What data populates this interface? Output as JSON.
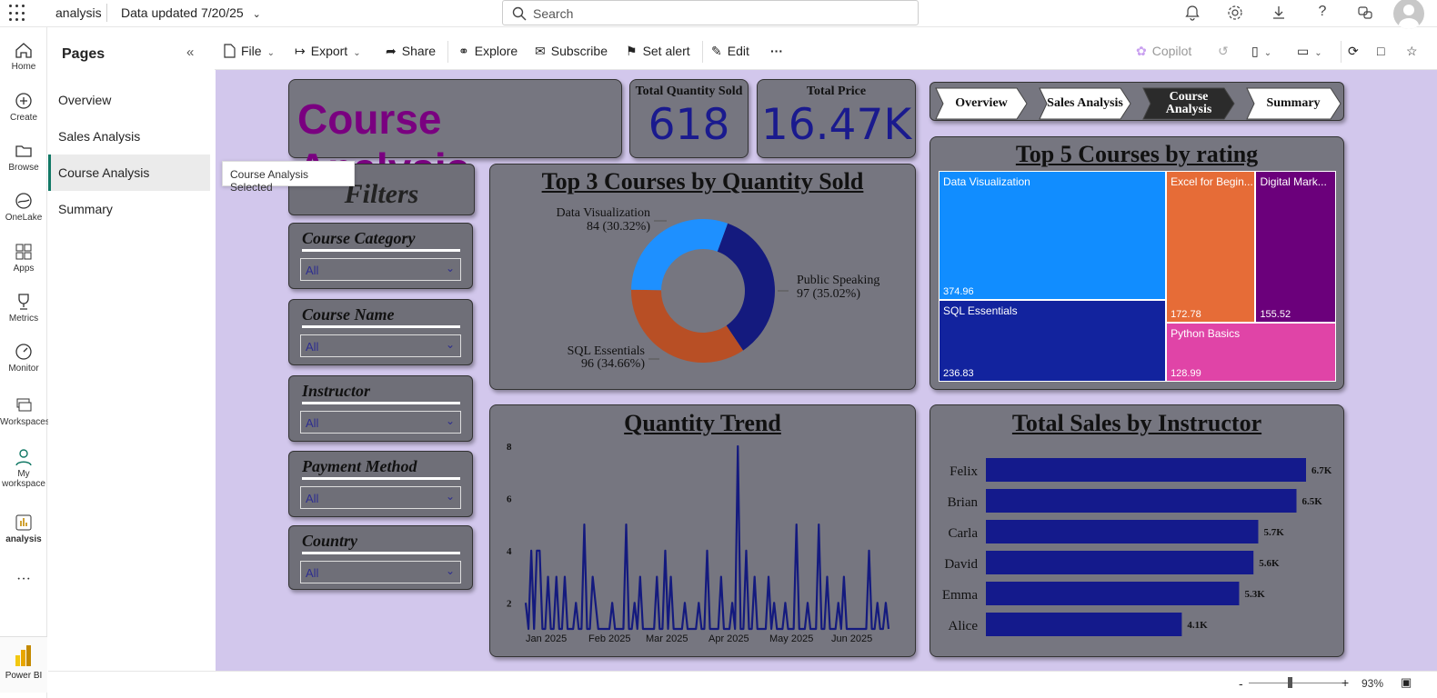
{
  "topbar": {
    "app_name": "analysis",
    "data_updated": "Data updated 7/20/25",
    "search_placeholder": "Search"
  },
  "leftnav": [
    {
      "label": "Home",
      "icon": "home-icon"
    },
    {
      "label": "Create",
      "icon": "plus-circle-icon"
    },
    {
      "label": "Browse",
      "icon": "folder-icon"
    },
    {
      "label": "OneLake",
      "icon": "onelake-icon"
    },
    {
      "label": "Apps",
      "icon": "apps-icon"
    },
    {
      "label": "Metrics",
      "icon": "trophy-icon"
    },
    {
      "label": "Monitor",
      "icon": "monitor-icon"
    },
    {
      "label": "Workspaces",
      "icon": "workspaces-icon"
    },
    {
      "label": "My workspace",
      "icon": "person-icon"
    },
    {
      "label": "analysis",
      "icon": "report-icon"
    },
    {
      "label": "...",
      "icon": "more-icon"
    }
  ],
  "powerbi_label": "Power BI",
  "pages_panel": {
    "title": "Pages",
    "items": [
      "Overview",
      "Sales Analysis",
      "Course Analysis",
      "Summary"
    ],
    "selected": "Course Analysis",
    "tooltip": "Course Analysis Selected"
  },
  "toolbar": {
    "file": "File",
    "export": "Export",
    "share": "Share",
    "explore": "Explore",
    "subscribe": "Subscribe",
    "set_alert": "Set alert",
    "edit": "Edit",
    "more": "···",
    "copilot": "Copilot"
  },
  "report": {
    "title": "Course Analysis",
    "kpi_qty_label": "Total Quantity Sold",
    "kpi_qty_value": "618",
    "kpi_price_label": "Total Price",
    "kpi_price_value": "16.47K",
    "nav_buttons": [
      "Overview",
      "Sales Analysis",
      "Course Analysis",
      "Summary"
    ],
    "filters_title": "Filters",
    "filters": [
      {
        "label": "Course Category",
        "value": "All"
      },
      {
        "label": "Course Name",
        "value": "All"
      },
      {
        "label": "Instructor",
        "value": "All"
      },
      {
        "label": "Payment Method",
        "value": "All"
      },
      {
        "label": "Country",
        "value": "All"
      }
    ]
  },
  "colors": {
    "canvas_bg": "#d2c7ec",
    "card_bg": "#767680",
    "title_purple": "#7a0080",
    "kpi_blue": "#1a1a8e",
    "bar_navy": "#141a8c"
  },
  "chart_data": [
    {
      "type": "pie",
      "title": "Top 3 Courses by Quantity Sold",
      "categories": [
        "Public Speaking",
        "SQL Essentials",
        "Data Visualization"
      ],
      "values": [
        97,
        96,
        84
      ],
      "labels": [
        "97 (35.02%)",
        "96 (34.66%)",
        "84 (30.32%)"
      ],
      "colors": [
        "#141a7e",
        "#b84f25",
        "#1e90ff"
      ]
    },
    {
      "type": "heatmap",
      "title": "Top 5 Courses by rating",
      "categories": [
        "Data Visualization",
        "SQL Essentials",
        "Excel for Begin...",
        "Digital Mark...",
        "Python Basics"
      ],
      "values": [
        374.96,
        236.83,
        172.78,
        155.52,
        128.99
      ],
      "value_labels": [
        "374.96",
        "236.83",
        "172.78",
        "155.52",
        "128.99"
      ],
      "colors": [
        "#118dff",
        "#12239e",
        "#e66c37",
        "#6b007b",
        "#e044a7"
      ]
    },
    {
      "type": "line",
      "title": "Quantity Trend",
      "x_ticks": [
        "Jan 2025",
        "Feb 2025",
        "Mar 2025",
        "Apr 2025",
        "May 2025",
        "Jun 2025"
      ],
      "y_ticks": [
        2,
        4,
        6,
        8
      ],
      "ylim": [
        1,
        8
      ],
      "values": [
        2,
        1,
        4,
        1,
        4,
        4,
        1,
        1,
        3,
        1,
        1,
        3,
        1,
        1,
        3,
        1,
        1,
        1,
        2,
        1,
        1,
        5,
        1,
        1,
        3,
        2,
        1,
        1,
        1,
        1,
        1,
        2,
        1,
        1,
        1,
        1,
        5,
        1,
        1,
        2,
        1,
        3,
        1,
        1,
        1,
        1,
        1,
        3,
        1,
        1,
        4,
        1,
        3,
        1,
        1,
        1,
        1,
        2,
        1,
        1,
        1,
        1,
        2,
        1,
        1,
        4,
        1,
        1,
        1,
        1,
        3,
        1,
        1,
        1,
        2,
        1,
        8,
        1,
        1,
        4,
        1,
        1,
        3,
        1,
        1,
        1,
        1,
        3,
        1,
        2,
        1,
        1,
        1,
        2,
        1,
        1,
        1,
        5,
        1,
        1,
        1,
        2,
        1,
        1,
        1,
        5,
        1,
        1,
        3,
        1,
        1,
        1,
        2,
        1,
        3,
        1,
        1,
        1,
        1,
        1,
        1,
        1,
        1,
        4,
        1,
        1,
        2,
        1,
        1,
        2,
        1
      ]
    },
    {
      "type": "bar",
      "title": "Total Sales by Instructor",
      "categories": [
        "Felix",
        "Brian",
        "Carla",
        "David",
        "Emma",
        "Alice"
      ],
      "values": [
        6.7,
        6.5,
        5.7,
        5.6,
        5.3,
        4.1
      ],
      "value_labels": [
        "6.7K",
        "6.5K",
        "5.7K",
        "5.6K",
        "5.3K",
        "4.1K"
      ],
      "xlim": [
        0,
        7.2
      ]
    }
  ],
  "statusbar": {
    "zoom": "93%"
  }
}
